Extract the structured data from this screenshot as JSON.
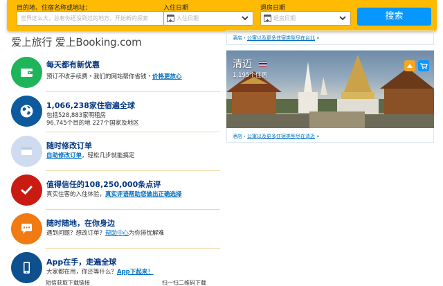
{
  "search": {
    "destination_label": "目的地、住宿名称或地址：",
    "destination_placeholder": "世界这么大，总有你还没到过的地方，开始新的探索",
    "checkin_label": "入住日期",
    "checkin_placeholder": "入住日期",
    "checkout_label": "退房日期",
    "checkout_placeholder": "退房日期",
    "search_button": "搜索"
  },
  "brand": {
    "slogan": "爱上旅行 爱上Booking.com"
  },
  "features": [
    {
      "title": "每天都有新优惠",
      "lines": [
        {
          "text": "预订不收手续费・我们的网站帮你省钱・",
          "link": "价格更放心"
        }
      ],
      "color": "#1fb45a",
      "icon": "wallet-icon"
    },
    {
      "title": "1,066,238家住宿遍全球",
      "lines": [
        {
          "text": "包括528,883家明租房"
        },
        {
          "text": "96,745个目的地 227个国家及地区"
        }
      ],
      "color": "#0e5a9e",
      "icon": "globe-icon"
    },
    {
      "title": "随时修改订单",
      "lines": [
        {
          "link": "自助修改订单",
          "text": "，轻松几步就能搞定"
        }
      ],
      "color": "#cfdcf0",
      "icon": "booking-card-icon"
    },
    {
      "title": "值得信任的108,250,000条点评",
      "lines": [
        {
          "text": "真实住客的入住体验，",
          "link": "真实评语帮助您做出正确选择"
        }
      ],
      "color": "#c91b12",
      "icon": "checkmark-icon"
    },
    {
      "title": "随时随地，在你身边",
      "lines": [
        {
          "text": "遇到问题？想改订单？",
          "link": "帮助中心",
          "text2": "为你排忧解难"
        }
      ],
      "color": "#f17a12",
      "icon": "chat-bubble-icon"
    },
    {
      "title": "App在手，走遍全球",
      "lines": [
        {
          "text": "大家都在用，你还等什么？",
          "link": "App下起来！"
        }
      ],
      "color": "#0e4f8e",
      "icon": "smartphone-icon"
    }
  ],
  "bottom_links": {
    "sms": "短信获取下载链接",
    "qr": "扫一扫二维码下载"
  },
  "right": {
    "top_link": {
      "prefix": "酒店・",
      "link": "公寓以及更多住宿类型尽在台北",
      "suffix": "»"
    },
    "city": {
      "name": "清迈",
      "count": "1,195个住宿"
    },
    "bottom_link": {
      "prefix": "酒店・",
      "link": "公寓以及更多住宿类型尽在清迈",
      "suffix": "»"
    }
  }
}
